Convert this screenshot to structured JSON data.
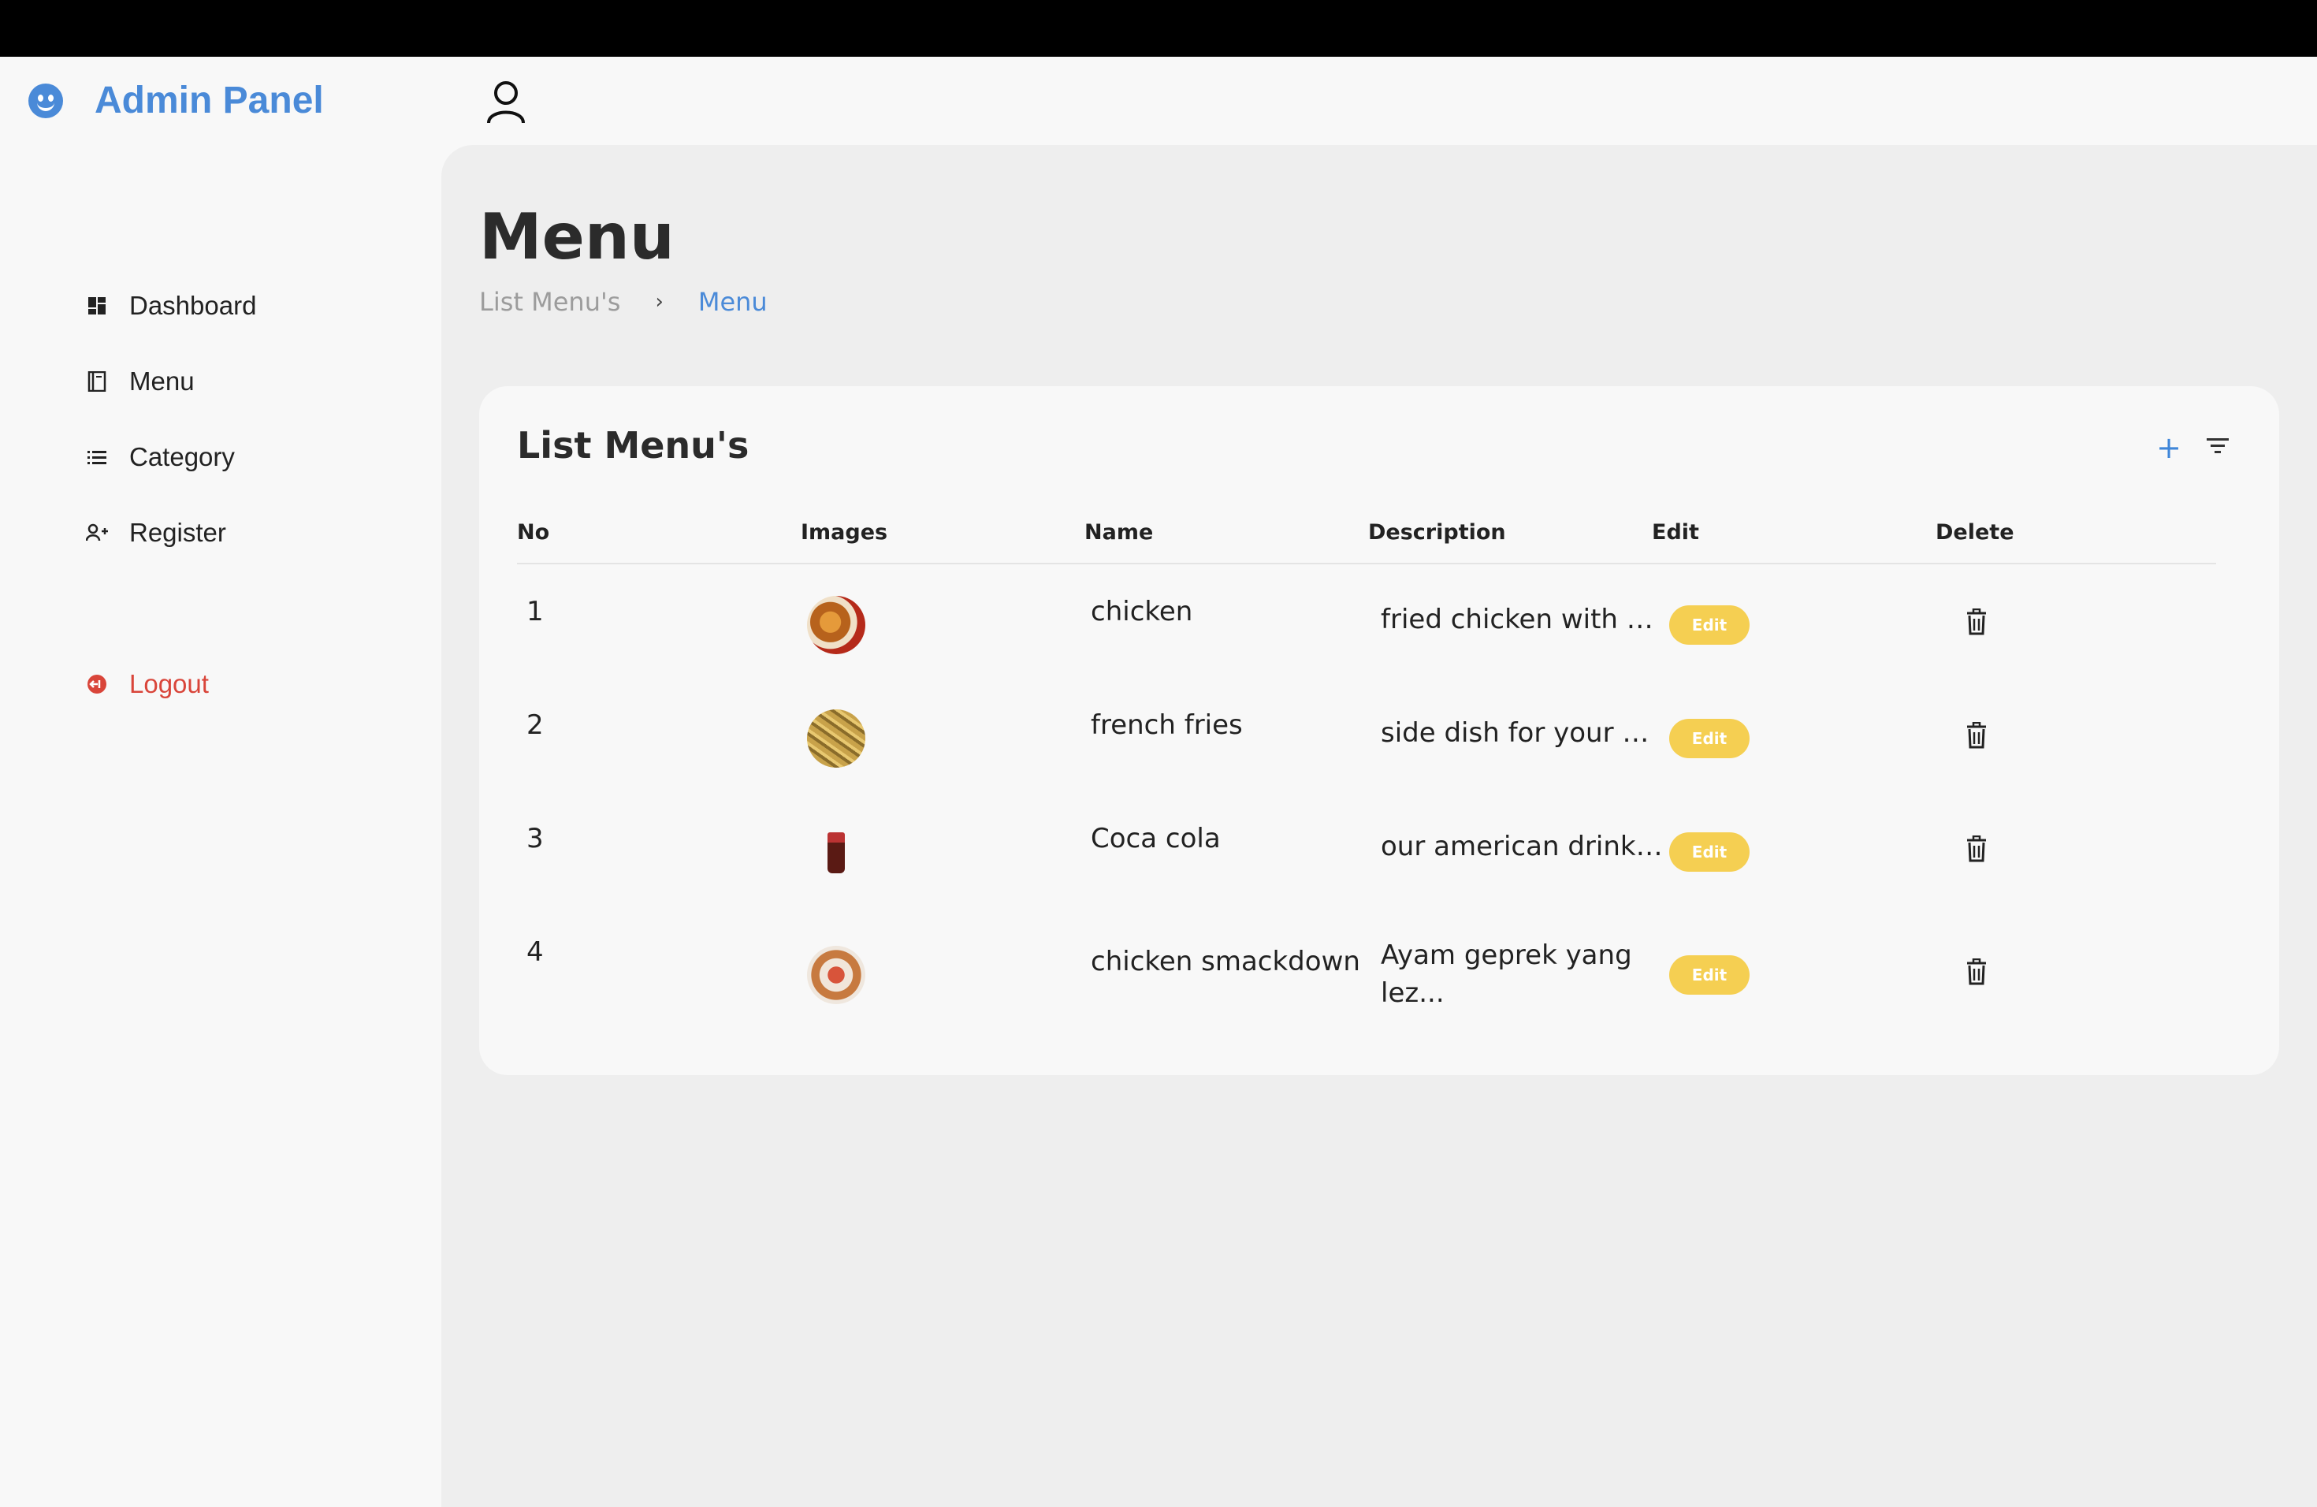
{
  "app": {
    "title": "Admin Panel"
  },
  "sidebar": {
    "items": [
      {
        "label": "Dashboard",
        "icon": "dashboard-icon"
      },
      {
        "label": "Menu",
        "icon": "book-icon"
      },
      {
        "label": "Category",
        "icon": "list-icon"
      },
      {
        "label": "Register",
        "icon": "add-user-icon"
      }
    ],
    "logout": {
      "label": "Logout",
      "icon": "logout-icon",
      "color": "#d9453a"
    }
  },
  "header": {
    "user_icon": "user-icon"
  },
  "page": {
    "title": "Menu",
    "breadcrumb": {
      "parent": "List Menu's",
      "separator": "›",
      "current": "Menu"
    }
  },
  "card": {
    "title": "List Menu's",
    "add_icon": "plus-icon",
    "filter_icon": "filter-icon",
    "columns": [
      "No",
      "Images",
      "Name",
      "Description",
      "Edit",
      "Delete"
    ],
    "rows": [
      {
        "no": "1",
        "image": "chicken-image",
        "name": "chicken",
        "description": "fried chicken with o...",
        "edit_label": "Edit"
      },
      {
        "no": "2",
        "image": "french-fries-image",
        "name": "french fries",
        "description": "side dish for your m...",
        "edit_label": "Edit"
      },
      {
        "no": "3",
        "image": "coca-cola-image",
        "name": "Coca cola",
        "description": "our american drink w...",
        "edit_label": "Edit"
      },
      {
        "no": "4",
        "image": "chicken-smackdown-image",
        "name": "chicken smackdown",
        "description": "Ayam geprek yang lez...",
        "edit_label": "Edit"
      }
    ]
  },
  "colors": {
    "accent": "#4a8ad8",
    "edit_button": "#f5cf52",
    "logout": "#d9453a"
  }
}
